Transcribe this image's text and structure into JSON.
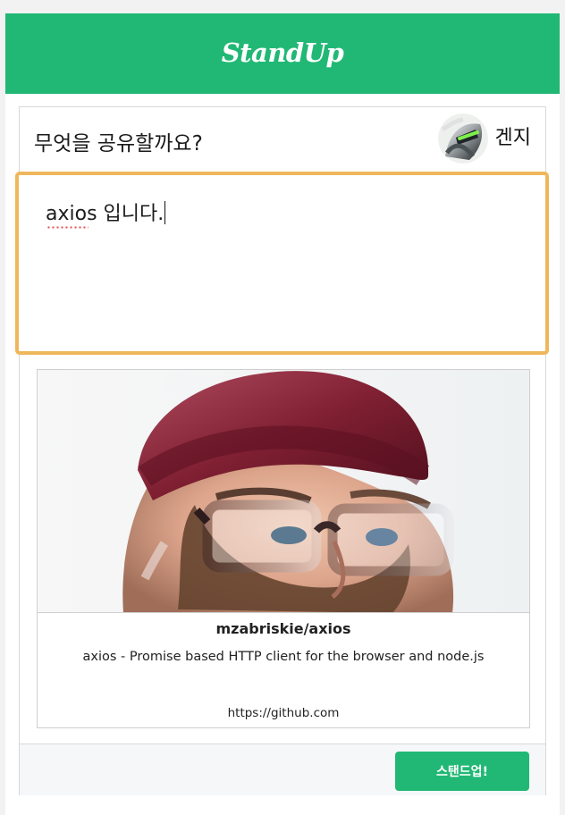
{
  "header": {
    "brand": "StandUp",
    "brand_color": "#21b875"
  },
  "composer": {
    "prompt": "무엇을 공유할까요?",
    "user": {
      "name": "겐지",
      "avatar_icon": "user-avatar-icon"
    },
    "input": {
      "value": "axios 입니다.",
      "focus_border_color": "#efb75b"
    },
    "preview": {
      "title": "mzabriskie/axios",
      "description": "axios - Promise based HTTP client for the browser and node.js",
      "url": "https://github.com"
    },
    "submit_label": "스탠드업!"
  }
}
